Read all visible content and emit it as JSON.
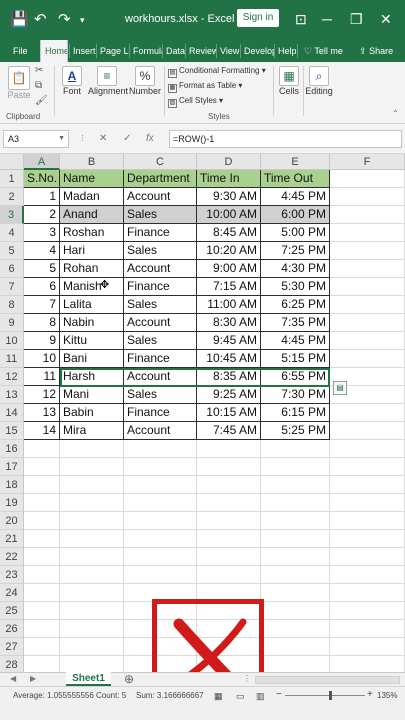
{
  "titlebar": {
    "filename": "workhours.xlsx",
    "separator": "-",
    "app": "Excel",
    "signin_label": "Sign in",
    "save_icon": "💾",
    "undo_icon": "↶",
    "redo_icon": "↷",
    "minimize_icon": "─",
    "restore_icon": "❐",
    "close_icon": "✕"
  },
  "menu": {
    "tabs": [
      "File",
      "Home",
      "Insert",
      "Page La",
      "Formula",
      "Data",
      "Review",
      "View",
      "Develop",
      "Help"
    ],
    "tell_me": "Tell me",
    "share": "Share",
    "active": "Home"
  },
  "ribbon": {
    "paste": "Paste",
    "font": "Font",
    "alignment": "Alignment",
    "number": "Number",
    "conditional_formatting": "Conditional Formatting ▾",
    "format_as_table": "Format as Table ▾",
    "cell_styles": "Cell Styles ▾",
    "cells": "Cells",
    "editing": "Editing",
    "clipboard_group": "Clipboard",
    "styles_group": "Styles"
  },
  "formula_bar": {
    "name_box": "A3",
    "cancel_icon": "✕",
    "enter_icon": "✓",
    "fx_label": "fx",
    "formula": "=ROW()-1"
  },
  "grid": {
    "columns": [
      "A",
      "B",
      "C",
      "D",
      "E",
      "F"
    ],
    "selected_column": "A",
    "selected_row": "3",
    "rows": [
      "1",
      "2",
      "3",
      "4",
      "5",
      "6",
      "7",
      "8",
      "9",
      "10",
      "11",
      "12",
      "13",
      "14",
      "15",
      "16",
      "17",
      "18",
      "19",
      "20",
      "21",
      "22",
      "23",
      "24",
      "25",
      "26",
      "27",
      "28"
    ],
    "table": {
      "headers": [
        "S.No.",
        "Name",
        "Department",
        "Time In",
        "Time Out"
      ],
      "data": [
        [
          "1",
          "Madan",
          "Account",
          "9:30 AM",
          "4:45 PM"
        ],
        [
          "2",
          "Anand",
          "Sales",
          "10:00 AM",
          "6:00 PM"
        ],
        [
          "3",
          "Roshan",
          "Finance",
          "8:45 AM",
          "5:00 PM"
        ],
        [
          "4",
          "Hari",
          "Sales",
          "10:20 AM",
          "7:25 PM"
        ],
        [
          "5",
          "Rohan",
          "Account",
          "9:00 AM",
          "4:30 PM"
        ],
        [
          "6",
          "Manish",
          "Finance",
          "7:15 AM",
          "5:30 PM"
        ],
        [
          "7",
          "Lalita",
          "Sales",
          "11:00 AM",
          "6:25 PM"
        ],
        [
          "8",
          "Nabin",
          "Account",
          "8:30 AM",
          "7:35 PM"
        ],
        [
          "9",
          "Kittu",
          "Sales",
          "9:45 AM",
          "4:45 PM"
        ],
        [
          "10",
          "Bani",
          "Finance",
          "10:45 AM",
          "5:15 PM"
        ],
        [
          "11",
          "Harsh",
          "Account",
          "8:35 AM",
          "6:55 PM"
        ],
        [
          "12",
          "Mani",
          "Sales",
          "9:25 AM",
          "7:30 PM"
        ],
        [
          "13",
          "Babin",
          "Finance",
          "10:15 AM",
          "6:15 PM"
        ],
        [
          "14",
          "Mira",
          "Account",
          "7:45 AM",
          "5:25 PM"
        ]
      ]
    },
    "header_fill": "#a9d08e",
    "selection_color": "#217346",
    "overlay_icon": "cross-mark-icon",
    "overlay_color": "#d11a1a"
  },
  "sheets": {
    "tabs": [
      "Sheet1"
    ],
    "add_icon": "⊕"
  },
  "status": {
    "average": "Average: 1.055555556",
    "count": "Count: 5",
    "sum": "Sum: 3.166666667",
    "zoom": "135%"
  },
  "colors": {
    "excel_green": "#217346"
  }
}
